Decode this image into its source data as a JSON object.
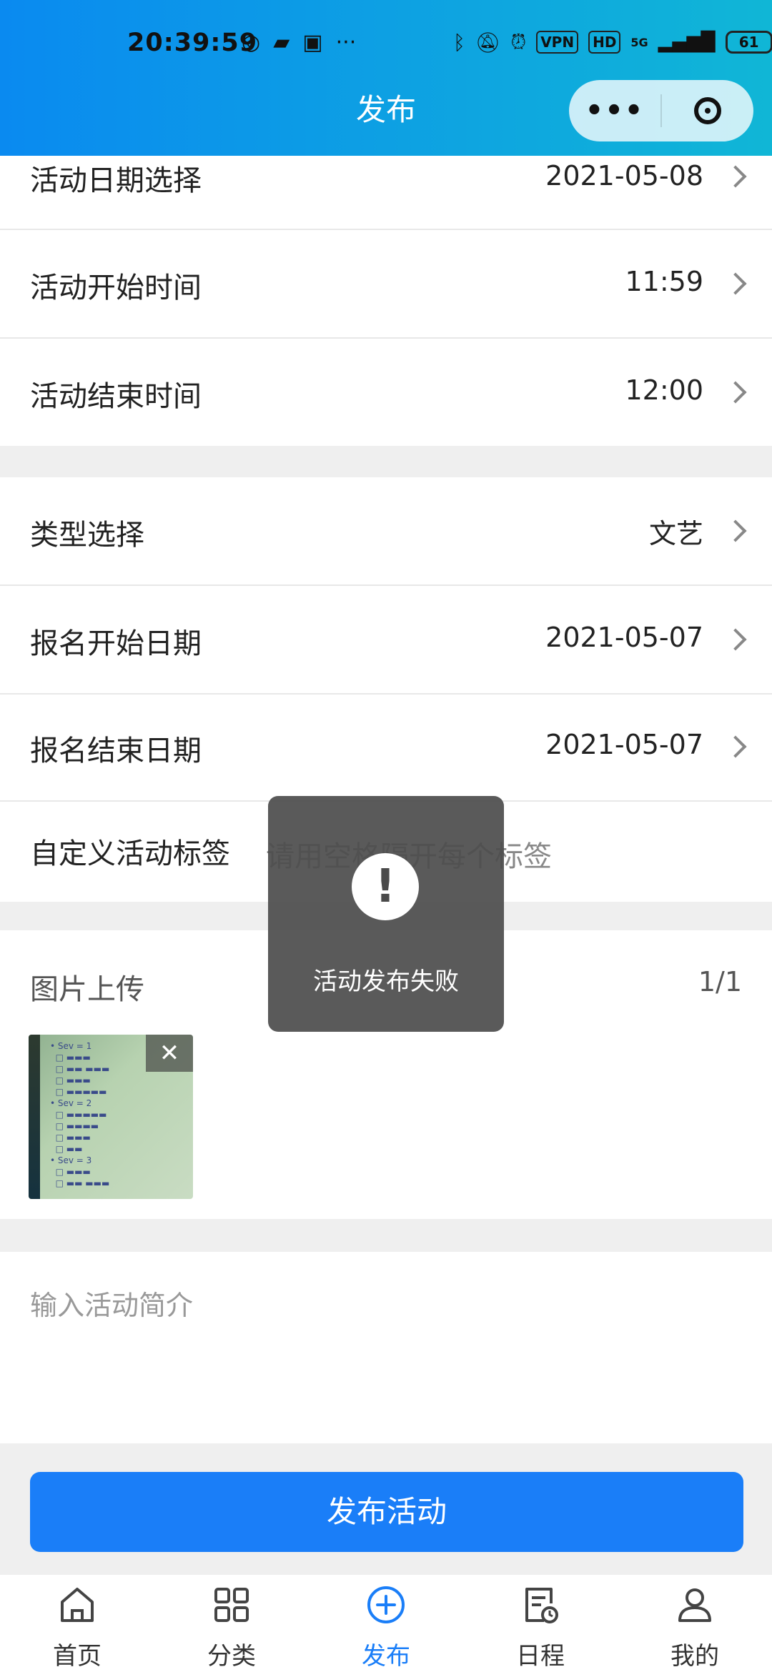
{
  "status_bar": {
    "time": "20:39:59",
    "network": "5G",
    "battery": "61",
    "vpn": "VPN",
    "hd": "HD"
  },
  "header": {
    "title": "发布",
    "more_label": "•••"
  },
  "form": {
    "activity_date": {
      "label": "活动日期选择",
      "value": "2021-05-08"
    },
    "start_time": {
      "label": "活动开始时间",
      "value": "11:59"
    },
    "end_time": {
      "label": "活动结束时间",
      "value": "12:00"
    },
    "type": {
      "label": "类型选择",
      "value": "文艺"
    },
    "signup_start": {
      "label": "报名开始日期",
      "value": "2021-05-07"
    },
    "signup_end": {
      "label": "报名结束日期",
      "value": "2021-05-07"
    },
    "tags": {
      "label": "自定义活动标签",
      "placeholder": "请用空格隔开每个标签"
    },
    "image_upload": {
      "label": "图片上传",
      "count": "1/1"
    },
    "intro": {
      "placeholder": "输入活动简介"
    }
  },
  "toast": {
    "icon": "!",
    "text": "活动发布失败"
  },
  "submit_button": {
    "label": "发布活动"
  },
  "tabbar": {
    "items": [
      {
        "label": "首页",
        "icon": "home-icon"
      },
      {
        "label": "分类",
        "icon": "grid-icon"
      },
      {
        "label": "发布",
        "icon": "plus-circle-icon",
        "active": true
      },
      {
        "label": "日程",
        "icon": "schedule-icon"
      },
      {
        "label": "我的",
        "icon": "user-icon"
      }
    ]
  },
  "colors": {
    "accent": "#1a7ef8",
    "header_start": "#0a8af0",
    "header_end": "#10b6d6"
  }
}
